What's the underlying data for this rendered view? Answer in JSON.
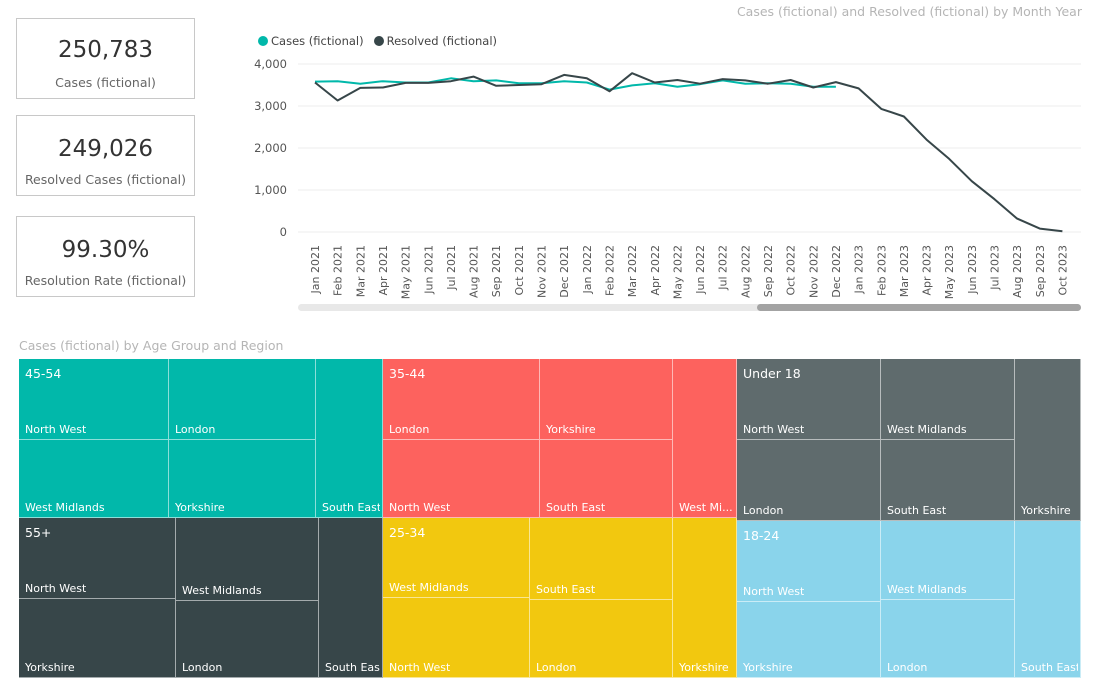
{
  "cards": [
    {
      "value": "250,783",
      "label": "Cases (fictional)"
    },
    {
      "value": "249,026",
      "label": "Resolved Cases (fictional)"
    },
    {
      "value": "99.30%",
      "label": "Resolution Rate (fictional)"
    }
  ],
  "chart_data": [
    {
      "type": "line",
      "title": "Cases (fictional) and Resolved (fictional)  by Month Year",
      "x": [
        "Jan 2021",
        "Feb 2021",
        "Mar 2021",
        "Apr 2021",
        "May 2021",
        "Jun 2021",
        "Jul 2021",
        "Aug 2021",
        "Sep 2021",
        "Oct 2021",
        "Nov 2021",
        "Dec 2021",
        "Jan 2022",
        "Feb 2022",
        "Mar 2022",
        "Apr 2022",
        "May 2022",
        "Jun 2022",
        "Jul 2022",
        "Aug 2022",
        "Sep 2022",
        "Oct 2022",
        "Nov 2022",
        "Dec 2022",
        "Jan 2023",
        "Feb 2023",
        "Mar 2023",
        "Apr 2023",
        "May 2023",
        "Jun 2023",
        "Jul 2023",
        "Aug 2023",
        "Sep 2023",
        "Oct 2023"
      ],
      "yticks": [
        "0",
        "1,000",
        "2,000",
        "3,000",
        "4,000"
      ],
      "ylim": [
        0,
        4000
      ],
      "legend_position": "top-left",
      "grid": true,
      "series": [
        {
          "name": "Cases (fictional)",
          "color": "#01b8aa",
          "values": [
            3580,
            3590,
            3530,
            3590,
            3560,
            3560,
            3660,
            3590,
            3610,
            3540,
            3540,
            3590,
            3560,
            3390,
            3490,
            3540,
            3460,
            3520,
            3610,
            3530,
            3540,
            3530,
            3460,
            3460
          ]
        },
        {
          "name": "Resolved (fictional)",
          "color": "#374649",
          "values": [
            3560,
            3130,
            3430,
            3440,
            3550,
            3550,
            3590,
            3700,
            3480,
            3500,
            3520,
            3740,
            3660,
            3350,
            3780,
            3560,
            3620,
            3530,
            3640,
            3610,
            3530,
            3620,
            3440,
            3570,
            3420,
            2930,
            2750,
            2200,
            1740,
            1210,
            780,
            320,
            80,
            20
          ]
        }
      ]
    },
    {
      "type": "treemap",
      "title": "Cases (fictional) by Age Group and Region",
      "groups": [
        {
          "name": "45-54",
          "color": "#01b8aa",
          "cells": [
            "North West",
            "London",
            "West Midlands",
            "Yorkshire",
            "South East"
          ]
        },
        {
          "name": "55+",
          "color": "#374649",
          "cells": [
            "North West",
            "West Midlands",
            "Yorkshire",
            "London",
            "South East"
          ]
        },
        {
          "name": "35-44",
          "color": "#fd625e",
          "cells": [
            "London",
            "Yorkshire",
            "North West",
            "South East",
            "West Mi..."
          ]
        },
        {
          "name": "25-34",
          "color": "#f2c80f",
          "cells": [
            "West Midlands",
            "South East",
            "North West",
            "London",
            "Yorkshire"
          ]
        },
        {
          "name": "Under 18",
          "color": "#5f6b6d",
          "cells": [
            "North West",
            "West Midlands",
            "London",
            "South East",
            "Yorkshire"
          ]
        },
        {
          "name": "18-24",
          "color": "#8ad4eb",
          "cells": [
            "North West",
            "West Midlands",
            "Yorkshire",
            "London",
            "South East"
          ]
        }
      ]
    }
  ]
}
